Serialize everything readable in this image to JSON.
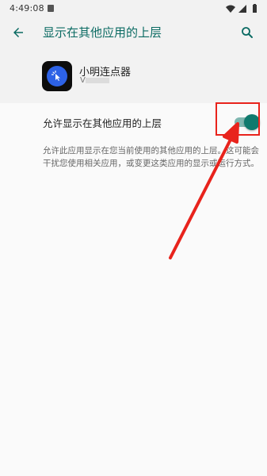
{
  "status_bar": {
    "time": "4:49:08"
  },
  "app_bar": {
    "title": "显示在其他应用的上层",
    "back_icon": "arrow-back-icon",
    "search_icon": "search-icon"
  },
  "app_info": {
    "name": "小明连点器",
    "version_prefix": "V"
  },
  "setting": {
    "label": "允许显示在其他应用的上层",
    "enabled": true,
    "description": "允许此应用显示在您当前使用的其他应用的上层。这可能会干扰您使用相关应用，或变更这类应用的显示或运行方式。"
  },
  "colors": {
    "accent": "#0b6b63",
    "switch_thumb": "#0f7a6e",
    "switch_track": "#7fb7b0",
    "annotation": "#e8231c"
  }
}
